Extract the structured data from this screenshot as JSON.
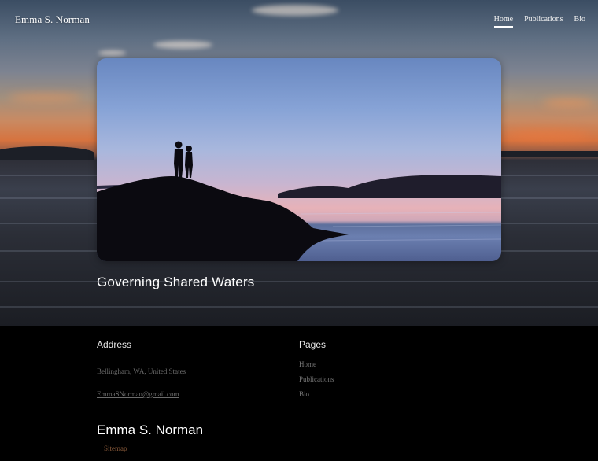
{
  "header": {
    "site_title": "Emma S. Norman",
    "nav": [
      {
        "label": "Home",
        "active": true
      },
      {
        "label": "Publications",
        "active": false
      },
      {
        "label": "Bio",
        "active": false
      }
    ]
  },
  "hero": {
    "heading": "Governing Shared Waters"
  },
  "footer": {
    "address_heading": "Address",
    "address_line": "Bellingham, WA, United States",
    "email": "EmmaSNorman@gmail.com",
    "pages_heading": "Pages",
    "pages": [
      "Home",
      "Publications",
      "Bio"
    ],
    "brand": "Emma S. Norman",
    "sitemap_label": "Sitemap"
  },
  "colors": {
    "footer_background": "#000000",
    "sitemap_link": "#8a5a3a",
    "nav_active_underline": "#ffffff"
  }
}
